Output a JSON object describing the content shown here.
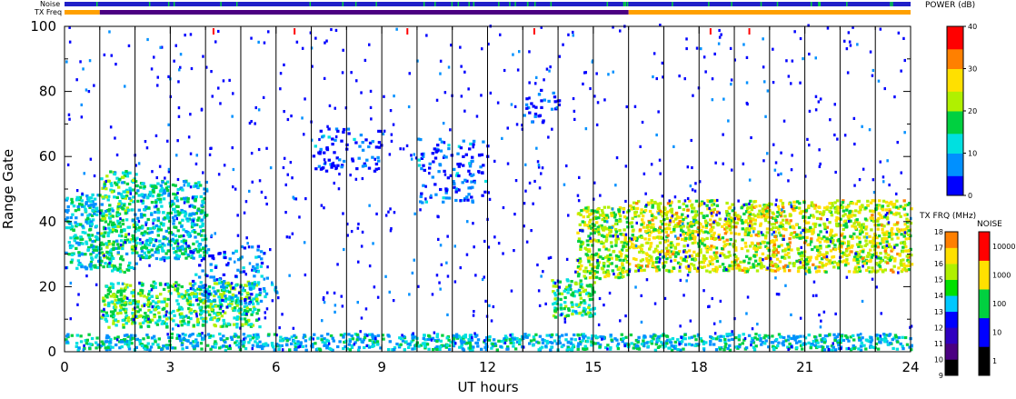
{
  "chart_data": {
    "type": "heatmap",
    "title": "",
    "xlabel": "UT hours",
    "ylabel": "Range Gate",
    "xlim": [
      0,
      24
    ],
    "ylim": [
      0,
      100
    ],
    "x_ticks": [
      0,
      3,
      6,
      9,
      12,
      15,
      18,
      21,
      24
    ],
    "x_tick_labels": [
      "0",
      "3",
      "6",
      "9",
      "12",
      "15",
      "18",
      "21",
      "24"
    ],
    "y_ticks": [
      0,
      20,
      40,
      60,
      80,
      100
    ],
    "y_tick_labels": [
      "0",
      "20",
      "40",
      "60",
      "80",
      "100"
    ],
    "scan_boundaries_ut": [
      1.0,
      2.0,
      3.0,
      4.0,
      5.0,
      6.0,
      7.0,
      8.0,
      9.0,
      10.0,
      11.0,
      12.0,
      13.0,
      14.0,
      15.0,
      16.0,
      17.0,
      18.0,
      19.0,
      20.0,
      21.0,
      22.0,
      23.0
    ],
    "regions": [
      {
        "ut": [
          0.0,
          1.0
        ],
        "gates": [
          25,
          48
        ],
        "power_db": 12
      },
      {
        "ut": [
          1.0,
          2.0
        ],
        "gates": [
          24,
          55
        ],
        "power_db": 16
      },
      {
        "ut": [
          2.0,
          4.0
        ],
        "gates": [
          28,
          52
        ],
        "power_db": 13
      },
      {
        "ut": [
          1.0,
          5.5
        ],
        "gates": [
          7,
          21
        ],
        "power_db": 17
      },
      {
        "ut": [
          3.5,
          6.0
        ],
        "gates": [
          14,
          32
        ],
        "power_db": 6
      },
      {
        "ut": [
          7.0,
          9.0
        ],
        "gates": [
          55,
          68
        ],
        "power_db": 4
      },
      {
        "ut": [
          10.0,
          12.0
        ],
        "gates": [
          45,
          65
        ],
        "power_db": 4
      },
      {
        "ut": [
          13.0,
          14.0
        ],
        "gates": [
          70,
          80
        ],
        "power_db": 4
      },
      {
        "ut": [
          13.8,
          15.0
        ],
        "gates": [
          10,
          22
        ],
        "power_db": 16
      },
      {
        "ut": [
          14.5,
          16.0
        ],
        "gates": [
          22,
          44
        ],
        "power_db": 22
      },
      {
        "ut": [
          16.0,
          24.0
        ],
        "gates": [
          24,
          46
        ],
        "power_db": 24
      },
      {
        "ut": [
          0.0,
          24.0
        ],
        "gates": [
          0,
          5
        ],
        "power_db": 12
      }
    ],
    "power_colorbar": {
      "title": "POWER (dB)",
      "ticks": [
        0,
        10,
        20,
        30,
        40
      ],
      "tick_labels": [
        "0",
        "10",
        "20",
        "30",
        "40"
      ],
      "colors": [
        "#0000ff",
        "#0090ff",
        "#00e0e0",
        "#00d040",
        "#b0f000",
        "#ffe000",
        "#ff8000",
        "#ff0000"
      ]
    },
    "freq_colorbar": {
      "title": "TX FRQ (MHz)",
      "ticks": [
        9,
        10,
        11,
        12,
        13,
        14,
        15,
        16,
        17,
        18
      ],
      "tick_labels": [
        "9",
        "10",
        "11",
        "12",
        "13",
        "14",
        "15",
        "16",
        "17",
        "18"
      ],
      "colors": [
        "#000000",
        "#4b0082",
        "#3000c0",
        "#0000ff",
        "#00c8ff",
        "#00e000",
        "#b0f000",
        "#ffe000",
        "#ff8000",
        "#ff0000"
      ]
    },
    "noise_colorbar": {
      "title": "NOISE",
      "ticks": [
        1,
        10,
        100,
        1000,
        10000
      ],
      "tick_labels": [
        "1",
        "10",
        "100",
        "1000",
        "10000"
      ],
      "colors": [
        "#000000",
        "#0000ff",
        "#00d040",
        "#ffe000",
        "#ff0000"
      ]
    },
    "status_bars": {
      "noise_label": "Noise",
      "txfreq_label": "TX Freq",
      "noise_color": "#2020c8",
      "noise_accent": "#00d040",
      "txfreq_segments": [
        {
          "ut": [
            0.0,
            1.0
          ],
          "color": "#ffa000"
        },
        {
          "ut": [
            1.0,
            16.0
          ],
          "color": "#4b0082"
        },
        {
          "ut": [
            16.0,
            24.0
          ],
          "color": "#ffa000"
        }
      ]
    }
  }
}
